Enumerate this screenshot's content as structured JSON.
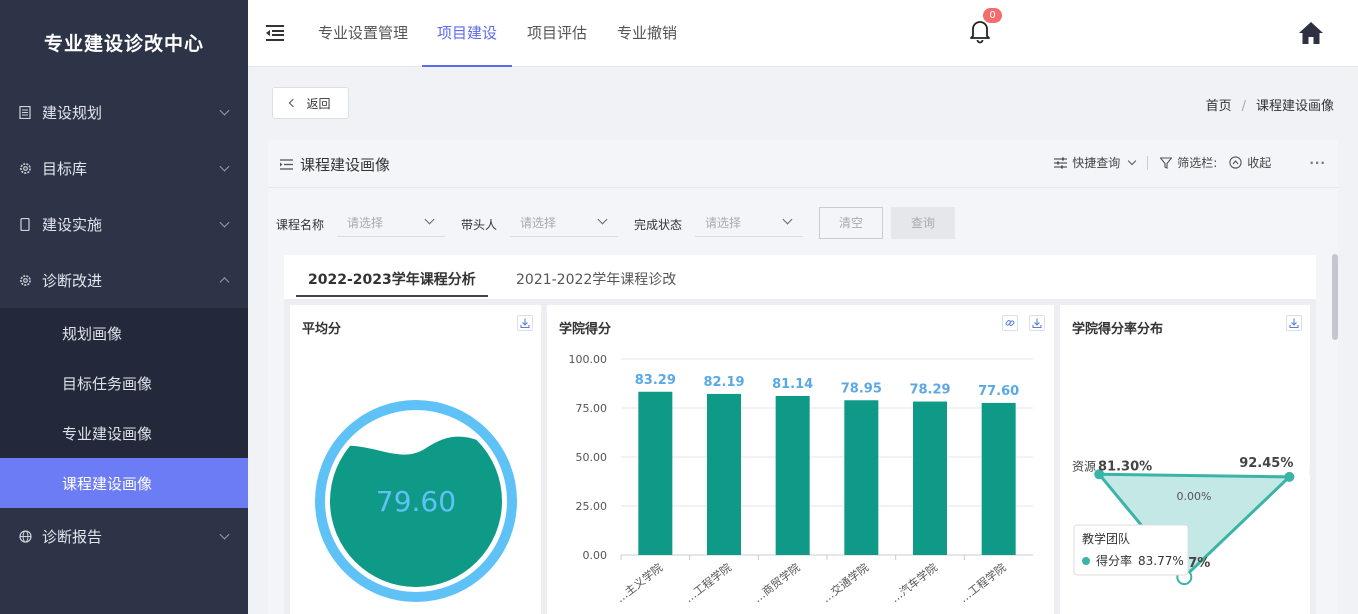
{
  "sidebar": {
    "brand": "专业建设诊改中心",
    "items": [
      {
        "label": "建设规划",
        "icon": "document-icon"
      },
      {
        "label": "目标库",
        "icon": "gear-icon"
      },
      {
        "label": "建设实施",
        "icon": "phone-icon"
      },
      {
        "label": "诊断改进",
        "icon": "gear-icon"
      }
    ],
    "submenu": [
      {
        "label": "规划画像"
      },
      {
        "label": "目标任务画像"
      },
      {
        "label": "专业建设画像"
      },
      {
        "label": "课程建设画像"
      }
    ],
    "after": [
      {
        "label": "诊断报告",
        "icon": "globe-icon"
      }
    ]
  },
  "topbar": {
    "tabs": [
      "专业设置管理",
      "项目建设",
      "项目评估",
      "专业撤销"
    ],
    "active_tab": "项目建设",
    "notifications": "0"
  },
  "page": {
    "back_label": "返回",
    "breadcrumb": [
      "首页",
      "课程建设画像"
    ]
  },
  "panel": {
    "title": "课程建设画像",
    "tools": {
      "quick_query": "快捷查询",
      "filter_bar": "筛选栏:",
      "collapse": "收起",
      "more": "···"
    },
    "filters": [
      {
        "label": "课程名称",
        "placeholder": "请选择"
      },
      {
        "label": "带头人",
        "placeholder": "请选择"
      },
      {
        "label": "完成状态",
        "placeholder": "请选择"
      }
    ],
    "clear_label": "清空",
    "query_label": "查询",
    "sub_tabs": [
      "2022-2023学年课程分析",
      "2021-2022学年课程诊改"
    ]
  },
  "cards": {
    "avg": {
      "title": "平均分",
      "value": "79.60",
      "fill_percent": 79.6
    },
    "college": {
      "title": "学院得分"
    },
    "radar": {
      "title": "学院得分率分布"
    }
  },
  "chart_data": [
    {
      "type": "bar",
      "title": "学院得分",
      "categories": [
        "…主义学院",
        "…工程学院",
        "…商贸学院",
        "…交通学院",
        "…汽车学院",
        "…工程学院"
      ],
      "values": [
        83.29,
        82.19,
        81.14,
        78.95,
        78.29,
        77.6
      ],
      "value_labels": [
        "83.29",
        "82.19",
        "81.14",
        "78.95",
        "78.29",
        "77.60"
      ],
      "y_ticks": [
        "100.00",
        "75.00",
        "50.00",
        "25.00",
        "0.00"
      ],
      "ylim": [
        0,
        100
      ],
      "grid": true,
      "bar_color": "#0e9a86",
      "label_color": "#5aa9e6"
    },
    {
      "type": "radar",
      "title": "学院得分率分布",
      "indicators": [
        "资源",
        "教学",
        "教学团队"
      ],
      "values": [
        81.3,
        92.45,
        83.77
      ],
      "value_labels": [
        "81.30%",
        "92.45%",
        "…77%"
      ],
      "center_label": "0.00%",
      "tooltip": {
        "title": "教学团队",
        "series": "得分率",
        "value": "83.77%"
      },
      "color": "#3bb4a8"
    }
  ]
}
